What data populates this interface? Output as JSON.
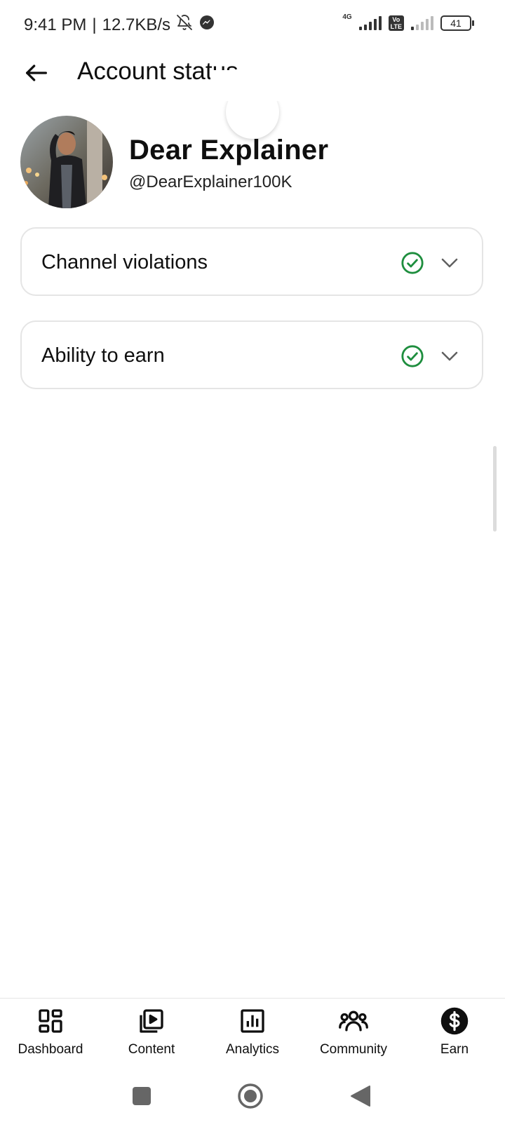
{
  "status_bar": {
    "time": "9:41 PM",
    "separator": "|",
    "speed": "12.7KB/s",
    "network_type": "4G",
    "volte_label_top": "Vo",
    "volte_label_bottom": "LTE",
    "battery": "41",
    "icons": [
      "bell-off-icon",
      "messenger-icon"
    ]
  },
  "header": {
    "title": "Account status",
    "back_icon": "arrow-left-icon"
  },
  "channel": {
    "name": "Dear Explainer",
    "handle": "@DearExplainer100K"
  },
  "status_cards": [
    {
      "label": "Channel violations",
      "status_icon": "check-circle-icon",
      "status_color": "#1e8e3e"
    },
    {
      "label": "Ability to earn",
      "status_icon": "check-circle-icon",
      "status_color": "#1e8e3e"
    }
  ],
  "bottom_nav": {
    "items": [
      {
        "label": "Dashboard",
        "icon": "dashboard-icon"
      },
      {
        "label": "Content",
        "icon": "content-icon"
      },
      {
        "label": "Analytics",
        "icon": "analytics-icon"
      },
      {
        "label": "Community",
        "icon": "community-icon"
      },
      {
        "label": "Earn",
        "icon": "earn-dollar-icon",
        "selected": true
      }
    ]
  },
  "system_nav": [
    "recents-button",
    "home-button",
    "back-button"
  ]
}
